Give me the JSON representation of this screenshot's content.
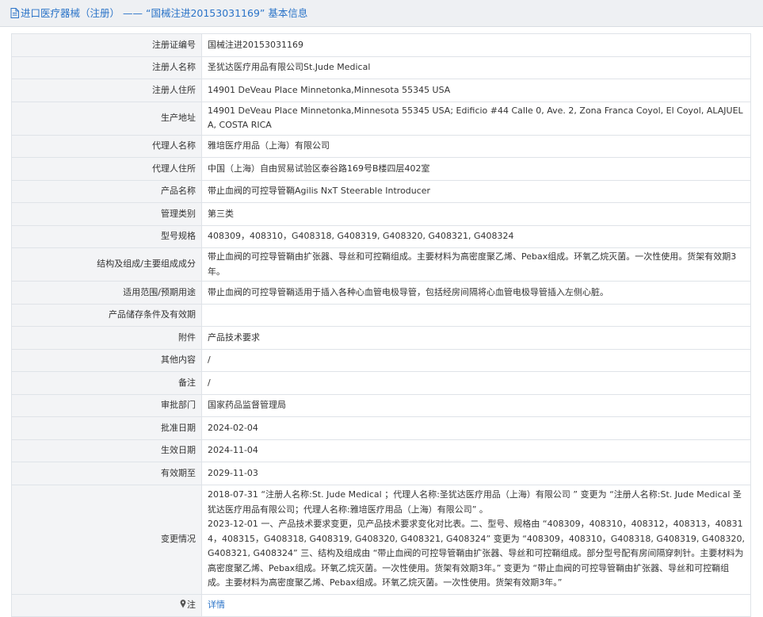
{
  "header": {
    "category_link": "进口医疗器械（注册）",
    "separator": " —— ",
    "title_prefix": "“国械注进20153031169”",
    "title_suffix": "基本信息"
  },
  "rows": [
    {
      "label": "注册证编号",
      "value": "国械注进20153031169"
    },
    {
      "label": "注册人名称",
      "value": "圣犹达医疗用品有限公司St.Jude Medical"
    },
    {
      "label": "注册人住所",
      "value": "14901 DeVeau Place Minnetonka,Minnesota 55345 USA"
    },
    {
      "label": "生产地址",
      "value": "14901 DeVeau Place Minnetonka,Minnesota 55345 USA; Edificio #44 Calle 0, Ave. 2, Zona Franca Coyol, El Coyol, ALAJUELA, COSTA RICA"
    },
    {
      "label": "代理人名称",
      "value": "雅培医疗用品（上海）有限公司"
    },
    {
      "label": "代理人住所",
      "value": "中国（上海）自由贸易试验区泰谷路169号B楼四层402室"
    },
    {
      "label": "产品名称",
      "value": "带止血阀的可控导管鞘Agilis NxT Steerable Introducer"
    },
    {
      "label": "管理类别",
      "value": "第三类"
    },
    {
      "label": "型号规格",
      "value": "408309，408310，G408318, G408319, G408320, G408321, G408324"
    },
    {
      "label": "结构及组成/主要组成成分",
      "value": "带止血阀的可控导管鞘由扩张器、导丝和可控鞘组成。主要材料为高密度聚乙烯、Pebax组成。环氧乙烷灭菌。一次性使用。货架有效期3年。"
    },
    {
      "label": "适用范围/预期用途",
      "value": "带止血阀的可控导管鞘适用于插入各种心血管电极导管，包括经房间隔将心血管电极导管插入左侧心脏。"
    },
    {
      "label": "产品储存条件及有效期",
      "value": ""
    },
    {
      "label": "附件",
      "value": "产品技术要求"
    },
    {
      "label": "其他内容",
      "value": "/"
    },
    {
      "label": "备注",
      "value": "/"
    },
    {
      "label": "审批部门",
      "value": "国家药品监督管理局"
    },
    {
      "label": "批准日期",
      "value": "2024-02-04"
    },
    {
      "label": "生效日期",
      "value": "2024-11-04"
    },
    {
      "label": "有效期至",
      "value": "2029-11-03"
    }
  ],
  "changes": {
    "label": "变更情况",
    "entry1": "2018-07-31 “注册人名称:St. Jude Medical ；代理人名称:圣犹达医疗用品（上海）有限公司 ” 变更为 “注册人名称:St. Jude Medical 圣犹达医疗用品有限公司；代理人名称:雅培医疗用品（上海）有限公司” 。",
    "entry2": "2023-12-01 一、产品技术要求变更，见产品技术要求变化对比表。二、型号、规格由 “408309，408310，408312，408313，408314，408315，G408318, G408319, G408320, G408321, G408324” 变更为 “408309，408310，G408318, G408319, G408320, G408321, G408324” 三、结构及组成由 “带止血阀的可控导管鞘由扩张器、导丝和可控鞘组成。部分型号配有房间隔穿刺针。主要材料为高密度聚乙烯、Pebax组成。环氧乙烷灭菌。一次性使用。货架有效期3年。” 变更为 “带止血阀的可控导管鞘由扩张器、导丝和可控鞘组成。主要材料为高密度聚乙烯、Pebax组成。环氧乙烷灭菌。一次性使用。货架有效期3年。”"
  },
  "note": {
    "label": "注",
    "link": "详情"
  },
  "colors": {
    "link": "#2a73c8",
    "label_bg": "#f3f4f6",
    "header_bg": "#eef0f3",
    "border": "#dfe3e8"
  },
  "icons": {
    "header": "document-icon",
    "note": "pin-icon"
  }
}
